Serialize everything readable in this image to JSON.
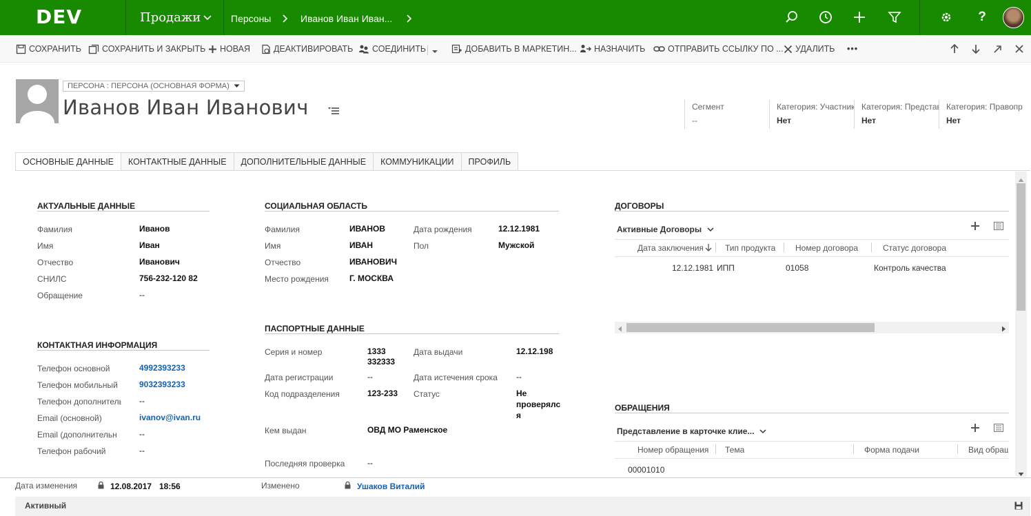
{
  "nav": {
    "logo": "DEV",
    "area": "Продажи",
    "breadcrumb": [
      "Персоны",
      "Иванов Иван Иван..."
    ]
  },
  "commands": {
    "save": "СОХРАНИТЬ",
    "save_close": "СОХРАНИТЬ И ЗАКРЫТЬ",
    "new": "НОВАЯ",
    "deactivate": "ДЕАКТИВИРОВАТЬ",
    "connect": "СОЕДИНИТЬ",
    "add_marketing": "ДОБАВИТЬ В МАРКЕТИН...",
    "assign": "НАЗНАЧИТЬ",
    "send_link": "ОТПРАВИТЬ ССЫЛКУ ПО ...",
    "delete": "УДАЛИТЬ",
    "more": "•••"
  },
  "header": {
    "form_selector": "ПЕРСОНА : ПЕРСОНА (ОСНОВНАЯ ФОРМА)",
    "full_name": "Иванов Иван Иванович",
    "fields": [
      {
        "label": "Сегмент",
        "value": "--"
      },
      {
        "label": "Категория: Участник",
        "value": "Нет"
      },
      {
        "label": "Категория: Представ",
        "value": "Нет"
      },
      {
        "label": "Категория: Правопр",
        "value": "Нет"
      }
    ]
  },
  "tabs": [
    "ОСНОВНЫЕ ДАННЫЕ",
    "КОНТАКТНЫЕ ДАННЫЕ",
    "ДОПОЛНИТЕЛЬНЫЕ ДАННЫЕ",
    "КОММУНИКАЦИИ",
    "ПРОФИЛЬ"
  ],
  "actual": {
    "title": "АКТУАЛЬНЫЕ ДАННЫЕ",
    "fields": [
      {
        "label": "Фамилия",
        "value": "Иванов"
      },
      {
        "label": "Имя",
        "value": "Иван"
      },
      {
        "label": "Отчество",
        "value": "Иванович"
      },
      {
        "label": "СНИЛС",
        "value": "756-232-120 82"
      },
      {
        "label": "Обращение",
        "value": "--"
      }
    ]
  },
  "contact": {
    "title": "КОНТАКТНАЯ ИНФОРМАЦИЯ",
    "fields": [
      {
        "label": "Телефон основной",
        "value": "4992393233"
      },
      {
        "label": "Телефон мобильный",
        "value": "9032393233"
      },
      {
        "label": "Телефон дополнитель",
        "value": "--"
      },
      {
        "label": "Email (основной)",
        "value": "ivanov@ivan.ru"
      },
      {
        "label": "Email (дополнительн",
        "value": "--"
      },
      {
        "label": "Телефон рабочий",
        "value": "--"
      }
    ]
  },
  "social": {
    "title": "СОЦИАЛЬНАЯ ОБЛАСТЬ",
    "left": [
      {
        "label": "Фамилия",
        "value": "ИВАНОВ"
      },
      {
        "label": "Имя",
        "value": "ИВАН"
      },
      {
        "label": "Отчество",
        "value": "ИВАНОВИЧ"
      },
      {
        "label": "Место рождения",
        "value": "Г. МОСКВА"
      }
    ],
    "right": [
      {
        "label": "Дата рождения",
        "value": "12.12.1981"
      },
      {
        "label": "Пол",
        "value": "Мужской"
      }
    ]
  },
  "passport": {
    "title": "ПАСПОРТНЫЕ ДАННЫЕ",
    "series_label": "Серия и номер",
    "series_line1": "1333",
    "series_line2": "332333",
    "issue_date_label": "Дата выдачи",
    "issue_date": "12.12.198",
    "reg_date_label": "Дата регистрации",
    "reg_date": "--",
    "expiry_label": "Дата истечения срока",
    "expiry": "--",
    "dept_label": "Код подразделения",
    "dept": "123-233",
    "status_label": "Статус",
    "status_line1": "Не",
    "status_line2": "проверялс",
    "status_line3": "я",
    "issuer_label": "Кем выдан",
    "issuer": "ОВД МО Раменское",
    "last_check_label": "Последняя проверка",
    "last_check": "--"
  },
  "contracts": {
    "title": "ДОГОВОРЫ",
    "view": "Активные Договоры",
    "columns": [
      "Дата заключения",
      "Тип продукта",
      "Номер договора",
      "Статус договора"
    ],
    "rows": [
      {
        "date": "12.12.1981",
        "type": "ИПП",
        "number": "01058",
        "status": "Контроль качества"
      }
    ]
  },
  "appeals": {
    "title": "ОБРАЩЕНИЯ",
    "view": "Представление в карточке клие...",
    "columns": [
      "Номер обращения",
      "Тема",
      "Форма подачи",
      "Вид обращ"
    ],
    "rows": [
      {
        "number": "00001010"
      }
    ]
  },
  "footer": {
    "modified_on_label": "Дата изменения",
    "modified_date": "12.08.2017",
    "modified_time": "18:56",
    "modified_by_label": "Изменено",
    "modified_by": "Ушаков Виталий",
    "status": "Активный"
  },
  "colors": {
    "nav_green": "#188a00",
    "link_blue": "#1660b3"
  }
}
